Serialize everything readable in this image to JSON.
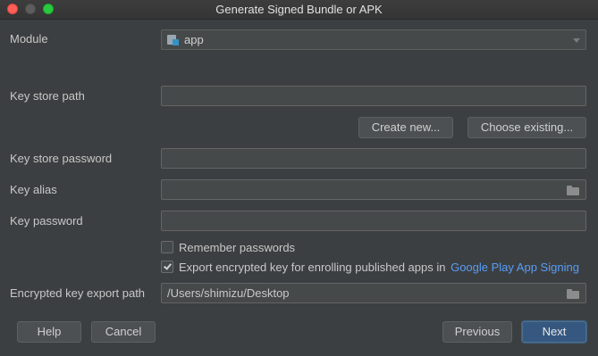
{
  "window": {
    "title": "Generate Signed Bundle or APK"
  },
  "module": {
    "label": "Module",
    "value": "app"
  },
  "key_store": {
    "path_label": "Key store path",
    "path_value": "",
    "create_new": "Create new...",
    "choose_existing": "Choose existing...",
    "password_label": "Key store password",
    "password_value": ""
  },
  "key": {
    "alias_label": "Key alias",
    "alias_value": "",
    "password_label": "Key password",
    "password_value": ""
  },
  "options": {
    "remember_label": "Remember passwords",
    "remember_checked": false,
    "export_label": "Export encrypted key for enrolling published apps in",
    "export_link": "Google Play App Signing",
    "export_checked": true
  },
  "export_path": {
    "label": "Encrypted key export path",
    "value": "/Users/shimizu/Desktop"
  },
  "footer": {
    "help": "Help",
    "cancel": "Cancel",
    "previous": "Previous",
    "next": "Next"
  },
  "colors": {
    "background": "#3c3f41",
    "link": "#589df6",
    "primary_button": "#365880"
  }
}
